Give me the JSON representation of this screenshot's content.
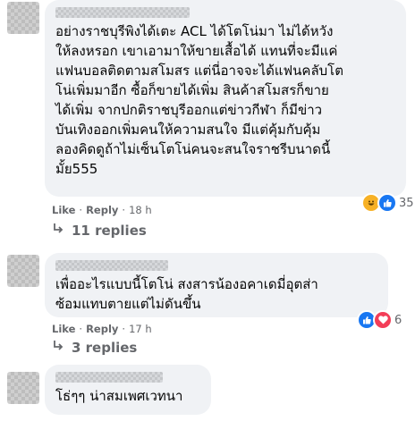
{
  "comments": [
    {
      "text": "อย่างราชบุรีพิงได้เตะ ACL ได้โตโน่มา ไม่ได้หวัง\nให้ลงหรอก เขาเอามาให้ขายเสื้อได้ แทนที่จะมีแค่\nแฟนบอลติดตามสโมสร แต่นี่อาจจะได้แฟนคลับโต\nโน่เพิ่มมาอีก ซื้อก็ขายได้เพิ่ม สินค้าสโมสรก็ขาย\nได้เพิ่ม จากปกติราชบุรีออกแต่ข่าวกีฬา ก็มีข่าว\nบันเทิงออกเพิ่มคนให้ความสนใจ มีแต่คุ้มกับคุ้ม\nลองคิดดูถ้าไม่เซ็นโตโน่คนจะสนใจราชรีบนาดนี้\nมั้ย555",
      "like": "Like",
      "reply": "Reply",
      "time": "18 h",
      "reaction_count": "35",
      "reaction_icons": [
        "laugh-icon",
        "like-icon"
      ],
      "replies_label": "11 replies"
    },
    {
      "text": "เพื่ออะไรแบบนี้โตโน่ สงสารน้องอคาเดมี่อุตส่า\nซ้อมแทบตายแต่ไม่ดันขึ้น",
      "like": "Like",
      "reply": "Reply",
      "time": "17 h",
      "reaction_count": "6",
      "reaction_icons": [
        "like-icon",
        "love-icon"
      ],
      "replies_label": "3 replies"
    },
    {
      "text": "โธ่ๆๆ น่าสมเพศเวทนา"
    }
  ],
  "separator": "·",
  "colors": {
    "like": "#1877f2",
    "love": "#f33e58",
    "laugh": "#f7b125",
    "meta": "#65676b",
    "bubble": "#f0f2f5"
  }
}
